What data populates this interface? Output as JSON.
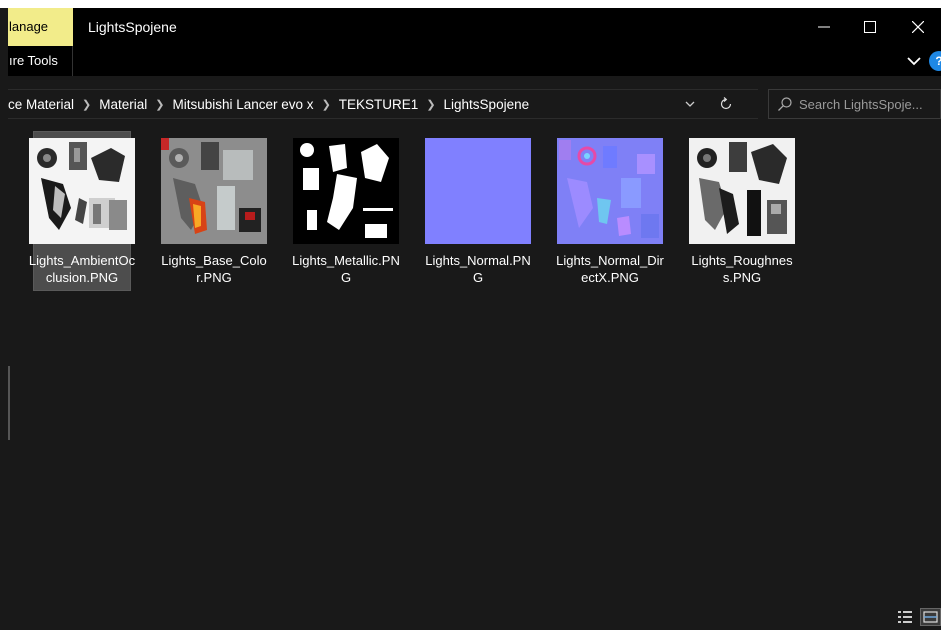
{
  "titlebar": {
    "manage_tab": "lanage",
    "window_title": "LightsSpojene"
  },
  "ribbon": {
    "tool_tab": "ıre Tools",
    "help_label": "?"
  },
  "address": {
    "crumbs": [
      "ce Material",
      "Material",
      "Mitsubishi Lancer evo x",
      "TEKSTURE1",
      "LightsSpojene"
    ],
    "search_placeholder": "Search LightsSpoje..."
  },
  "files": [
    {
      "name": "Lights_AmbientOcclusion.PNG",
      "selected": true
    },
    {
      "name": "Lights_Base_Color.PNG",
      "selected": false
    },
    {
      "name": "Lights_Metallic.PNG",
      "selected": false
    },
    {
      "name": "Lights_Normal.PNG",
      "selected": false
    },
    {
      "name": "Lights_Normal_DirectX.PNG",
      "selected": false
    },
    {
      "name": "Lights_Roughness.PNG",
      "selected": false
    }
  ],
  "colors": {
    "background": "#191919",
    "titlebar": "#000000",
    "manage_tab": "#f2ec8a",
    "selection": "#4d4d4d",
    "normal_map": "#8080ff",
    "accent": "#1e88e5"
  },
  "icons": {
    "minimize": "minimize-icon",
    "maximize": "maximize-icon",
    "close": "close-icon",
    "ribbon_expand": "chevron-down-icon",
    "refresh": "refresh-icon",
    "search": "search-icon",
    "details_view": "details-view-icon",
    "large_icons_view": "large-icons-view-icon"
  }
}
